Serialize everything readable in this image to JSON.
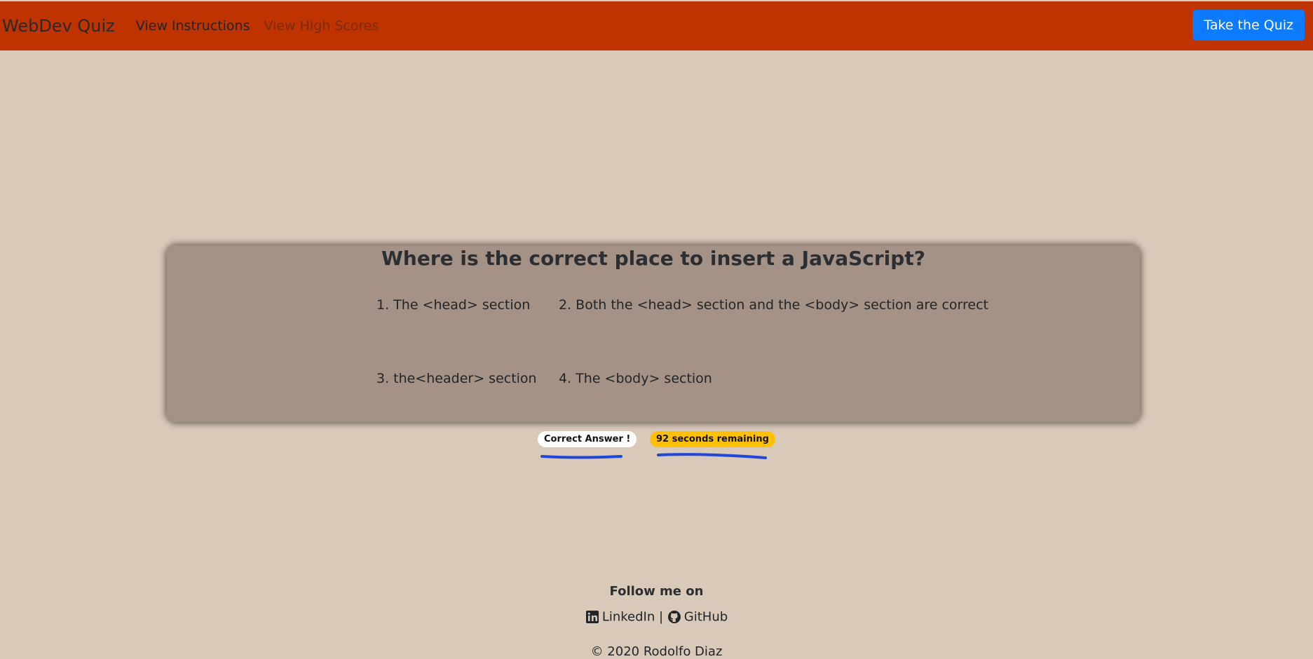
{
  "navbar": {
    "brand": "WebDev Quiz",
    "links": [
      "View Instructions",
      "View High Scores"
    ],
    "cta_label": "Take the Quiz",
    "background_color": "#bf3300",
    "cta_color": "#0d7bff"
  },
  "quiz": {
    "question": "Where is the correct place to insert a JavaScript?",
    "choices": [
      "1. The <head> section",
      "2. Both the <head> section and the <body> section are correct",
      "3. the<header> section",
      "4. The <body> section"
    ]
  },
  "status": {
    "feedback": "Correct Answer !",
    "timer": "92 seconds remaining",
    "timer_color": "#ffc107"
  },
  "footer": {
    "follow_text": "Follow me on",
    "linkedin_label": "LinkedIn",
    "separator": "|",
    "github_label": "GitHub",
    "copyright": "© 2020 Rodolfo Diaz",
    "linkedin_icon": "linkedin-icon",
    "github_icon": "github-icon"
  },
  "theme": {
    "page_background": "#d9c9b9",
    "card_background": "#a59286"
  }
}
